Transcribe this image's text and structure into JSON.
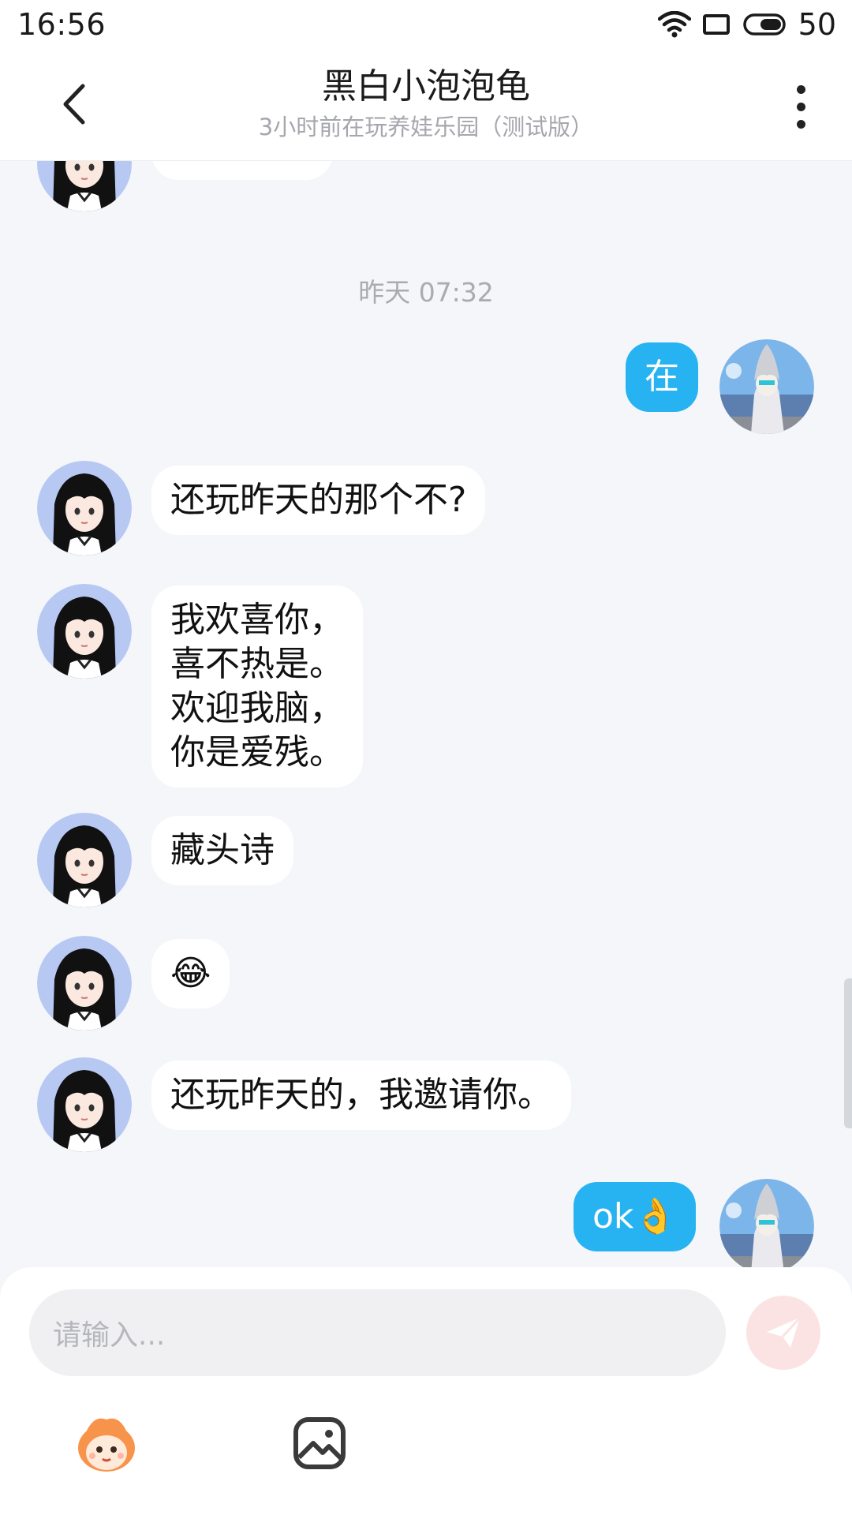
{
  "status_bar": {
    "time": "16:56",
    "battery": "50"
  },
  "header": {
    "title": "黑白小泡泡龟",
    "subtitle": "3小时前在玩养娃乐园（测试版）"
  },
  "chat": {
    "timestamp": "昨天 07:32",
    "messages": [
      {
        "from": "me",
        "text": "在"
      },
      {
        "from": "other",
        "text": "还玩昨天的那个不?"
      },
      {
        "from": "other",
        "text": "我欢喜你，\n喜不热是。\n欢迎我脑，\n你是爱残。"
      },
      {
        "from": "other",
        "text": "藏头诗"
      },
      {
        "from": "other",
        "text": "😂"
      },
      {
        "from": "other",
        "text": "还玩昨天的，我邀请你。"
      },
      {
        "from": "me",
        "text": "ok👌"
      }
    ]
  },
  "input": {
    "placeholder": "请输入..."
  },
  "icons": {
    "back": "chevron-left-icon",
    "more": "more-vertical-icon",
    "send": "paper-plane-icon",
    "mascot": "mascot-face-icon",
    "image": "image-icon"
  },
  "colors": {
    "my_bubble": "#27b3f2",
    "other_bubble": "#ffffff",
    "send_button": "#fbe3e3"
  }
}
